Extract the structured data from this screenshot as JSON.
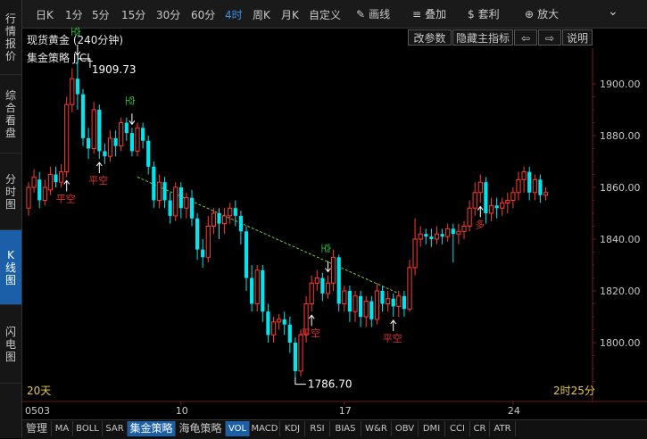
{
  "left_nav": [
    {
      "label": "行情报价",
      "active": false
    },
    {
      "label": "综合看盘",
      "active": false
    },
    {
      "label": "分时图",
      "active": false
    },
    {
      "label": "K线图",
      "active": true
    },
    {
      "label": "闪电图",
      "active": false
    }
  ],
  "toolbar": {
    "periods": [
      "日K",
      "1分",
      "5分",
      "15分",
      "30分",
      "60分",
      "4时",
      "周K",
      "月K",
      "自定义"
    ],
    "active_period": "4时",
    "tools": [
      {
        "label": "画线",
        "icon": "pencil-icon"
      },
      {
        "label": "叠加",
        "icon": "layers-icon"
      },
      {
        "label": "套利",
        "icon": "money-bag-icon"
      },
      {
        "label": "放大",
        "icon": "zoom-in-icon"
      }
    ]
  },
  "title": "现货黄金 (240分钟)",
  "indicator_label": "集金策略 JJCL",
  "buttons": {
    "params": "改参数",
    "hide": "隐藏主指标",
    "help": "说明"
  },
  "chart_data": {
    "type": "candlestick",
    "price_axis": {
      "ticks": [
        1900.0,
        1880.0,
        1860.0,
        1840.0,
        1820.0,
        1800.0
      ],
      "range": [
        1783,
        1912
      ]
    },
    "x_labels": [
      {
        "label": "0503",
        "index": 0
      },
      {
        "label": "10",
        "index": 28
      },
      {
        "label": "17",
        "index": 58
      },
      {
        "label": "24",
        "index": 89
      }
    ],
    "annotations": {
      "high": "1909.73",
      "low": "1786.70",
      "left_info": "20天",
      "right_info": "2时25分"
    },
    "candles": [
      [
        1852,
        1860,
        1849,
        1862
      ],
      [
        1860,
        1864,
        1858,
        1867
      ],
      [
        1863,
        1855,
        1852,
        1866
      ],
      [
        1855,
        1860,
        1853,
        1863
      ],
      [
        1859,
        1865,
        1857,
        1868
      ],
      [
        1865,
        1862,
        1860,
        1868
      ],
      [
        1862,
        1866,
        1860,
        1869
      ],
      [
        1866,
        1892,
        1864,
        1895
      ],
      [
        1892,
        1902,
        1889,
        1906
      ],
      [
        1902,
        1896,
        1890,
        1909.7
      ],
      [
        1896,
        1879,
        1876,
        1898
      ],
      [
        1879,
        1875,
        1871,
        1883
      ],
      [
        1875,
        1890,
        1873,
        1893
      ],
      [
        1890,
        1874,
        1871,
        1892
      ],
      [
        1874,
        1872,
        1869,
        1877
      ],
      [
        1872,
        1879,
        1870,
        1882
      ],
      [
        1879,
        1876,
        1872,
        1882
      ],
      [
        1876,
        1885,
        1874,
        1887
      ],
      [
        1885,
        1881,
        1878,
        1887
      ],
      [
        1881,
        1874,
        1872,
        1883
      ],
      [
        1874,
        1883,
        1872,
        1885
      ],
      [
        1883,
        1878,
        1875,
        1885
      ],
      [
        1878,
        1868,
        1865,
        1880
      ],
      [
        1868,
        1855,
        1852,
        1870
      ],
      [
        1855,
        1862,
        1852,
        1865
      ],
      [
        1862,
        1855,
        1852,
        1864
      ],
      [
        1855,
        1849,
        1846,
        1858
      ],
      [
        1849,
        1860,
        1847,
        1862
      ],
      [
        1860,
        1852,
        1848,
        1862
      ],
      [
        1852,
        1856,
        1848,
        1858
      ],
      [
        1856,
        1848,
        1845,
        1859
      ],
      [
        1848,
        1836,
        1832,
        1850
      ],
      [
        1836,
        1833,
        1829,
        1840
      ],
      [
        1833,
        1845,
        1831,
        1849
      ],
      [
        1845,
        1850,
        1842,
        1852
      ],
      [
        1850,
        1846,
        1840,
        1852
      ],
      [
        1846,
        1849,
        1842,
        1852
      ],
      [
        1849,
        1852,
        1846,
        1854
      ],
      [
        1852,
        1849,
        1845,
        1855
      ],
      [
        1849,
        1843,
        1838,
        1851
      ],
      [
        1843,
        1825,
        1820,
        1845
      ],
      [
        1825,
        1815,
        1812,
        1830
      ],
      [
        1815,
        1828,
        1812,
        1830
      ],
      [
        1828,
        1812,
        1808,
        1830
      ],
      [
        1812,
        1803,
        1800,
        1815
      ],
      [
        1803,
        1808,
        1800,
        1810
      ],
      [
        1808,
        1809,
        1805,
        1811
      ],
      [
        1809,
        1807,
        1803,
        1812
      ],
      [
        1807,
        1800,
        1796,
        1810
      ],
      [
        1800,
        1789,
        1786.7,
        1802
      ],
      [
        1789,
        1803,
        1787,
        1805
      ],
      [
        1803,
        1815,
        1800,
        1818
      ],
      [
        1815,
        1823,
        1812,
        1826
      ],
      [
        1823,
        1825,
        1820,
        1828
      ],
      [
        1825,
        1819,
        1816,
        1827
      ],
      [
        1819,
        1823,
        1817,
        1826
      ],
      [
        1823,
        1833,
        1820,
        1836
      ],
      [
        1833,
        1815,
        1812,
        1834
      ],
      [
        1815,
        1820,
        1812,
        1822
      ],
      [
        1820,
        1812,
        1808,
        1822
      ],
      [
        1812,
        1818,
        1808,
        1820
      ],
      [
        1818,
        1810,
        1806,
        1820
      ],
      [
        1810,
        1816,
        1806,
        1818
      ],
      [
        1816,
        1809,
        1806,
        1818
      ],
      [
        1809,
        1820,
        1807,
        1823
      ],
      [
        1820,
        1815,
        1812,
        1822
      ],
      [
        1815,
        1817,
        1812,
        1820
      ],
      [
        1817,
        1814,
        1810,
        1819
      ],
      [
        1814,
        1818,
        1810,
        1820
      ],
      [
        1818,
        1813,
        1810,
        1820
      ],
      [
        1813,
        1829,
        1812,
        1832
      ],
      [
        1829,
        1840,
        1826,
        1848
      ],
      [
        1840,
        1842,
        1837,
        1845
      ],
      [
        1842,
        1841,
        1838,
        1844
      ],
      [
        1841,
        1840,
        1837,
        1844
      ],
      [
        1840,
        1842,
        1838,
        1845
      ],
      [
        1842,
        1841,
        1838,
        1844
      ],
      [
        1841,
        1844,
        1839,
        1846
      ],
      [
        1844,
        1842,
        1831,
        1846
      ],
      [
        1842,
        1843,
        1838,
        1846
      ],
      [
        1843,
        1845,
        1840,
        1847
      ],
      [
        1845,
        1852,
        1843,
        1855
      ],
      [
        1852,
        1858,
        1849,
        1862
      ],
      [
        1858,
        1862,
        1854,
        1865
      ],
      [
        1862,
        1850,
        1846,
        1864
      ],
      [
        1850,
        1853,
        1847,
        1856
      ],
      [
        1853,
        1852,
        1848,
        1856
      ],
      [
        1852,
        1854,
        1849,
        1856
      ],
      [
        1854,
        1855,
        1850,
        1858
      ],
      [
        1855,
        1858,
        1852,
        1860
      ],
      [
        1858,
        1863,
        1855,
        1866
      ],
      [
        1863,
        1866,
        1858,
        1868
      ],
      [
        1866,
        1858,
        1855,
        1868
      ],
      [
        1858,
        1863,
        1855,
        1865
      ],
      [
        1863,
        1857,
        1854,
        1865
      ],
      [
        1857,
        1858,
        1855,
        1860
      ]
    ],
    "signals": [
      {
        "index": 7,
        "label": "平空",
        "color": "#e0302e",
        "pos": "below",
        "arrow": "up"
      },
      {
        "index": 9,
        "label": "空",
        "color": "#2ecc40",
        "pos": "above",
        "arrow": "down"
      },
      {
        "index": 13,
        "label": "平空",
        "color": "#e0302e",
        "pos": "below",
        "arrow": "up"
      },
      {
        "index": 19,
        "label": "空",
        "color": "#2ecc40",
        "pos": "above",
        "arrow": "down"
      },
      {
        "index": 52,
        "label": "平空",
        "color": "#e0302e",
        "pos": "below",
        "arrow": "up"
      },
      {
        "index": 55,
        "label": "空",
        "color": "#2ecc40",
        "pos": "above",
        "arrow": "down"
      },
      {
        "index": 67,
        "label": "平空",
        "color": "#e0302e",
        "pos": "below",
        "arrow": "up"
      },
      {
        "index": 83,
        "label": "多",
        "color": "#e0302e",
        "pos": "below",
        "arrow": "up"
      }
    ],
    "trendline": {
      "from": [
        20,
        1864
      ],
      "to": [
        68,
        1819
      ],
      "color": "#7acc3a"
    }
  },
  "bottom_tabs": [
    {
      "label": "管理",
      "active": false
    },
    {
      "label": "MA",
      "active": false
    },
    {
      "label": "BOLL",
      "active": false
    },
    {
      "label": "SAR",
      "active": false
    },
    {
      "label": "集金策略",
      "active": true
    },
    {
      "label": "海龟策略",
      "active": false
    },
    {
      "label": "VOL",
      "active": true
    },
    {
      "label": "MACD",
      "active": false
    },
    {
      "label": "KDJ",
      "active": false
    },
    {
      "label": "RSI",
      "active": false
    },
    {
      "label": "BIAS",
      "active": false
    },
    {
      "label": "W&R",
      "active": false
    },
    {
      "label": "OBV",
      "active": false
    },
    {
      "label": "DMI",
      "active": false
    },
    {
      "label": "CCI",
      "active": false
    },
    {
      "label": "CR",
      "active": false
    },
    {
      "label": "ATR",
      "active": false
    }
  ]
}
